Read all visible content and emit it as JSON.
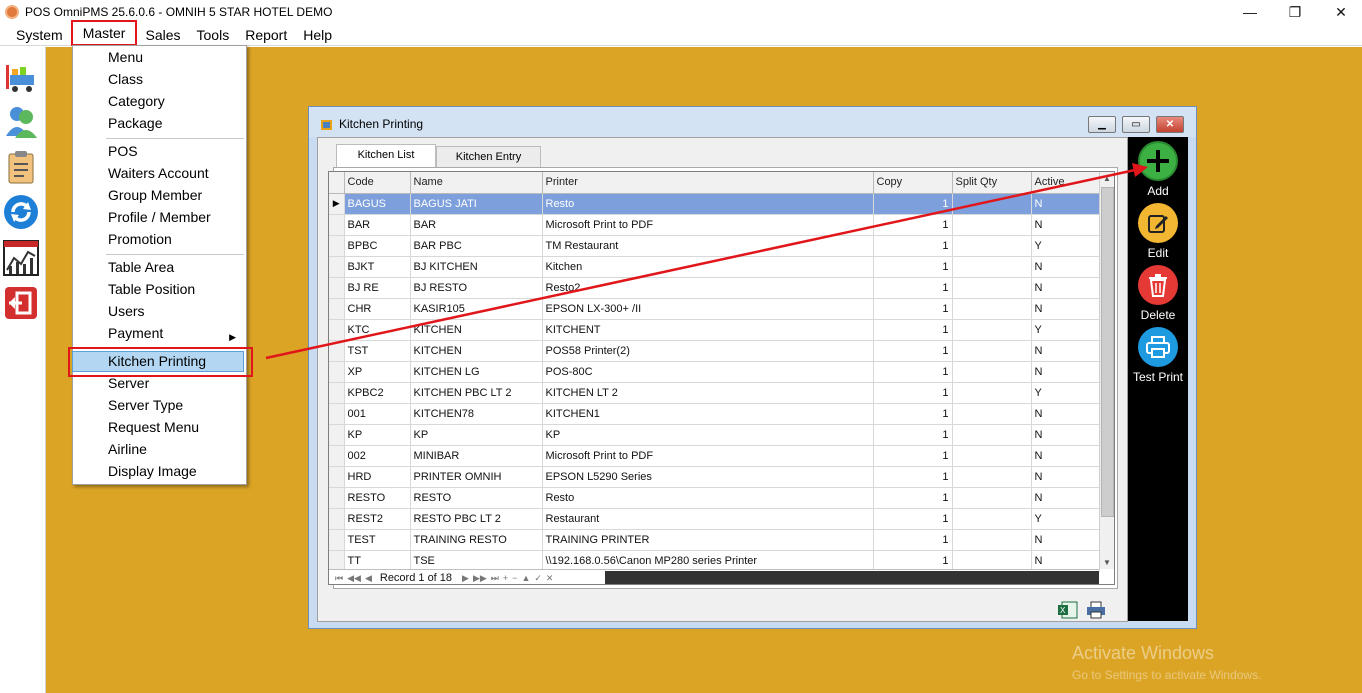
{
  "app": {
    "title": "POS OmniPMS 25.6.0.6 - OMNIH 5 STAR HOTEL DEMO",
    "minimize_glyph": "—",
    "restore_glyph": "❐",
    "close_glyph": "✕"
  },
  "menubar": {
    "items": [
      "System",
      "Master",
      "Sales",
      "Tools",
      "Report",
      "Help"
    ],
    "active": "Master"
  },
  "left_toolbar": {
    "icons": [
      "shopping-cart-icon",
      "users-icon",
      "clipboard-icon",
      "refresh-icon",
      "chart-icon",
      "exit-icon"
    ]
  },
  "master_menu": {
    "group1": [
      "Menu",
      "Class",
      "Category",
      "Package"
    ],
    "group2": [
      "POS",
      "Waiters Account",
      "Group Member",
      "Profile / Member",
      "Promotion"
    ],
    "group3": [
      "Table Area",
      "Table Position",
      "Users",
      "Payment"
    ],
    "group4": [
      "Kitchen Printing",
      "Server",
      "Server Type",
      "Request Menu",
      "Airline",
      "Display Image"
    ],
    "highlighted": "Kitchen Printing",
    "submenu_arrow": "▶"
  },
  "dialog": {
    "title": "Kitchen Printing",
    "tabs": [
      "Kitchen List",
      "Kitchen Entry"
    ],
    "selected_tab": "Kitchen List",
    "columns": [
      "Code",
      "Name",
      "Printer",
      "Copy",
      "Split Qty",
      "Active"
    ],
    "rows": [
      [
        "BAGUS",
        "BAGUS JATI",
        "Resto",
        "1",
        "",
        "N"
      ],
      [
        "BAR",
        "BAR",
        "Microsoft Print to PDF",
        "1",
        "",
        "N"
      ],
      [
        "BPBC",
        "BAR PBC",
        "TM Restaurant",
        "1",
        "",
        "Y"
      ],
      [
        "BJKT",
        "BJ KITCHEN",
        "Kitchen",
        "1",
        "",
        "N"
      ],
      [
        "BJ RE",
        "BJ RESTO",
        "Resto2",
        "1",
        "",
        "N"
      ],
      [
        "CHR",
        "KASIR105",
        "EPSON LX-300+ /II",
        "1",
        "",
        "N"
      ],
      [
        "KTC",
        "KITCHEN",
        "KITCHENT",
        "1",
        "",
        "Y"
      ],
      [
        "TST",
        "KITCHEN",
        "POS58 Printer(2)",
        "1",
        "",
        "N"
      ],
      [
        "XP",
        "KITCHEN LG",
        "POS-80C",
        "1",
        "",
        "N"
      ],
      [
        "KPBC2",
        "KITCHEN PBC LT 2",
        "KITCHEN LT 2",
        "1",
        "",
        "Y"
      ],
      [
        "001",
        "KITCHEN78",
        "KITCHEN1",
        "1",
        "",
        "N"
      ],
      [
        "KP",
        "KP",
        "KP",
        "1",
        "",
        "N"
      ],
      [
        "002",
        "MINIBAR",
        "Microsoft Print to PDF",
        "1",
        "",
        "N"
      ],
      [
        "HRD",
        "PRINTER OMNIH",
        "EPSON L5290 Series",
        "1",
        "",
        "N"
      ],
      [
        "RESTO",
        "RESTO",
        "Resto",
        "1",
        "",
        "N"
      ],
      [
        "REST2",
        "RESTO PBC LT 2",
        "Restaurant",
        "1",
        "",
        "Y"
      ],
      [
        "TEST",
        "TRAINING RESTO",
        "TRAINING PRINTER",
        "1",
        "",
        "N"
      ],
      [
        "TT",
        "TSE",
        "\\\\192.168.0.56\\Canon MP280 series Printer",
        "1",
        "",
        "N"
      ]
    ],
    "selected_row_index": 0,
    "row_indicator": "▶",
    "record_text": "Record 1 of 18"
  },
  "right_toolbar": {
    "buttons": [
      {
        "label": "Add",
        "color": "#3cb043",
        "icon": "plus-icon"
      },
      {
        "label": "Edit",
        "color": "#f2b632",
        "icon": "edit-icon"
      },
      {
        "label": "Delete",
        "color": "#e53935",
        "icon": "trash-icon"
      },
      {
        "label": "Test Print",
        "color": "#1e9be0",
        "icon": "printer-icon"
      }
    ]
  },
  "watermark": {
    "line1": "Activate Windows",
    "line2": "Go to Settings to activate Windows."
  },
  "colors": {
    "desktop": "#dba425",
    "selection": "#7d9fdc",
    "annotation": "#e0161a"
  }
}
